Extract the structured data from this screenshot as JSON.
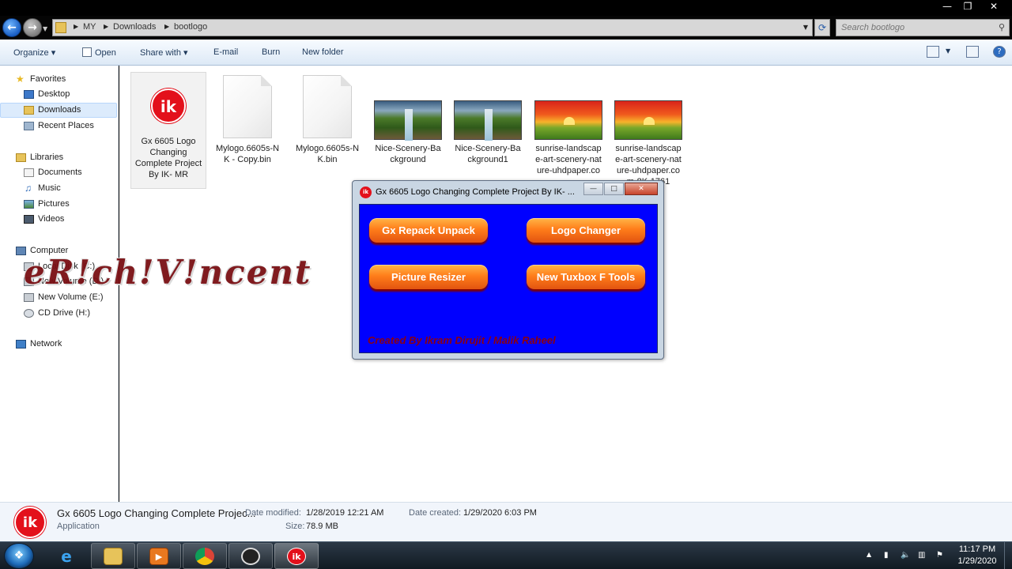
{
  "window": {
    "minimize": "—",
    "maximize": "❐",
    "close": "✕"
  },
  "address": {
    "crumbs": [
      "MY",
      "Downloads",
      "bootlogo"
    ],
    "search_placeholder": "Search bootlogo"
  },
  "toolbar": {
    "organize": "Organize ▾",
    "open": "Open",
    "share_with": "Share with ▾",
    "email": "E-mail",
    "burn": "Burn",
    "new_folder": "New folder"
  },
  "nav": {
    "favorites": "Favorites",
    "desktop": "Desktop",
    "downloads": "Downloads",
    "recent_places": "Recent Places",
    "libraries": "Libraries",
    "documents": "Documents",
    "music": "Music",
    "pictures": "Pictures",
    "videos": "Videos",
    "computer": "Computer",
    "local_disk": "Local Disk (C:)",
    "new_volume_d": "New Volume (D:)",
    "new_volume_e": "New Volume (E:)",
    "cd_drive": "CD Drive (H:)",
    "network": "Network"
  },
  "files": [
    {
      "name": "Gx 6605 Logo Changing Complete Project By IK- MR",
      "icon": "ik-app-icon"
    },
    {
      "name": "Mylogo.6605s-NK - Copy.bin",
      "icon": "blank-file-icon"
    },
    {
      "name": "Mylogo.6605s-NK.bin",
      "icon": "blank-file-icon"
    },
    {
      "name": "Nice-Scenery-Background",
      "icon": "scenery-thumbnail"
    },
    {
      "name": "Nice-Scenery-Background1",
      "icon": "scenery-thumbnail"
    },
    {
      "name": "sunrise-landscape-art-scenery-nature-uhdpaper.com-8K-176",
      "icon": "sunrise-thumbnail"
    },
    {
      "name": "sunrise-landscape-art-scenery-nature-uhdpaper.com-8K-1761",
      "icon": "sunrise-thumbnail"
    }
  ],
  "watermark": "eR!ch!V!ncent",
  "dialog": {
    "icon_text": "ik",
    "title": "Gx 6605 Logo Changing Complete Project By IK- ...",
    "buttons": {
      "gx_repack": "Gx Repack Unpack",
      "logo_changer": "Logo Changer",
      "picture_resizer": "Picture Resizer",
      "tuxbox": "New Tuxbox F Tools"
    },
    "credit": "Created By Ikram Dirujit / Malik Raheel"
  },
  "details": {
    "icon_text": "ik",
    "name": "Gx 6605 Logo Changing Complete Projec...",
    "type": "Application",
    "date_modified_label": "Date modified:",
    "date_modified": "1/28/2019 12:21 AM",
    "size_label": "Size:",
    "size": "78.9 MB",
    "date_created_label": "Date created:",
    "date_created": "1/29/2020 6:03 PM"
  },
  "taskbar": {
    "apps": [
      "internet-explorer-icon",
      "file-explorer-icon",
      "media-player-icon",
      "chrome-icon",
      "obs-icon",
      "ik-app-icon"
    ],
    "active_app_text": "ik",
    "time": "11:17 PM",
    "date": "1/29/2020"
  },
  "colors": {
    "dialog_body": "#0000ff",
    "button_orange": "#ff7d1a",
    "brand_red": "#e3101b",
    "credit_text": "#8b0010"
  }
}
